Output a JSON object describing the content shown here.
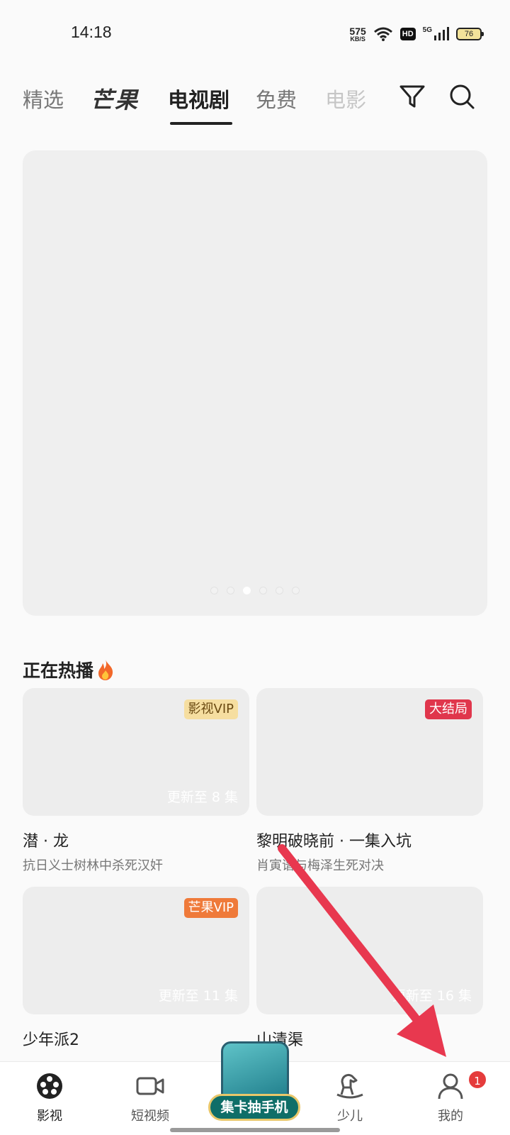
{
  "status_bar": {
    "time": "14:18",
    "net_speed": "575",
    "net_unit": "KB/S",
    "hd": "HD",
    "network": "5G",
    "battery": "76"
  },
  "top_tabs": [
    {
      "label": "精选"
    },
    {
      "label": "芒果"
    },
    {
      "label": "电视剧"
    },
    {
      "label": "免费"
    },
    {
      "label": "电影"
    }
  ],
  "icons": {
    "filter": "filter-icon",
    "search": "search-icon"
  },
  "banner": {
    "dot_count": 6,
    "active_dot": 2
  },
  "section": {
    "title": "正在热播"
  },
  "cards": [
    {
      "badge": "影视VIP",
      "update": "更新至 8 集",
      "title": "潜 · 龙",
      "subtitle": "抗日义士树林中杀死汉奸"
    },
    {
      "badge": "大结局",
      "update": "",
      "title": "黎明破晓前 · 一集入坑",
      "subtitle": "肖寅谱与梅泽生死对决"
    },
    {
      "badge": "芒果VIP",
      "update": "更新至 11 集",
      "title": "少年派2",
      "subtitle": ""
    },
    {
      "badge": "",
      "update": "更新至 16 集",
      "title": "山清渠",
      "subtitle": ""
    }
  ],
  "bottom_nav": [
    {
      "label": "影视"
    },
    {
      "label": "短视频"
    },
    {
      "label": "少儿"
    },
    {
      "label": "我的"
    }
  ],
  "promo": {
    "label": "集卡抽手机"
  },
  "notification_count": "1",
  "colors": {
    "accent": "#222222",
    "notif": "#e53c3c",
    "arrow": "#e8384f"
  }
}
